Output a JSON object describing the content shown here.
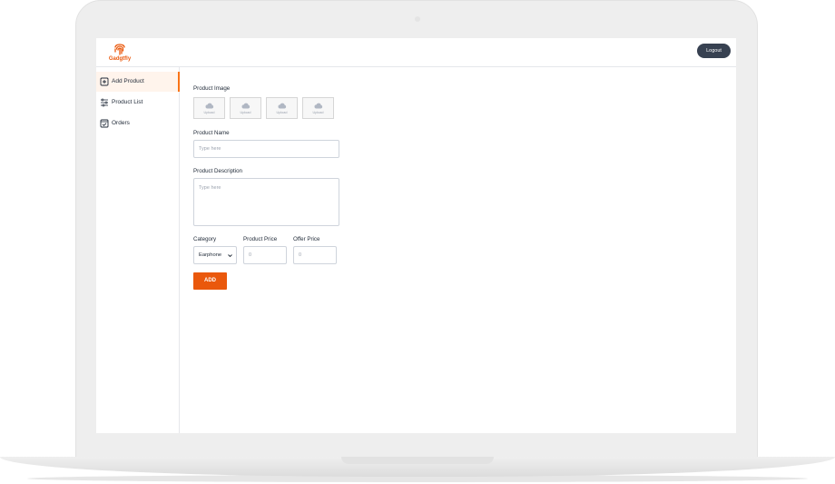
{
  "brand": {
    "name": "Gadgtfly",
    "accent": "#ea580c"
  },
  "header": {
    "logout_label": "Logout"
  },
  "sidebar": {
    "items": [
      {
        "label": "Add Product",
        "icon": "add-box-icon",
        "active": true
      },
      {
        "label": "Product List",
        "icon": "list-filter-icon",
        "active": false
      },
      {
        "label": "Orders",
        "icon": "order-check-icon",
        "active": false
      }
    ]
  },
  "form": {
    "image_label": "Product Image",
    "uploads": [
      {
        "label": "Upload"
      },
      {
        "label": "Upload"
      },
      {
        "label": "Upload"
      },
      {
        "label": "Upload"
      }
    ],
    "name_label": "Product Name",
    "name_placeholder": "Type here",
    "description_label": "Product Description",
    "description_placeholder": "Type here",
    "category_label": "Category",
    "category_value": "Earphone",
    "price_label": "Product Price",
    "price_placeholder": "0",
    "offer_label": "Offer Price",
    "offer_placeholder": "0",
    "submit_label": "ADD"
  }
}
